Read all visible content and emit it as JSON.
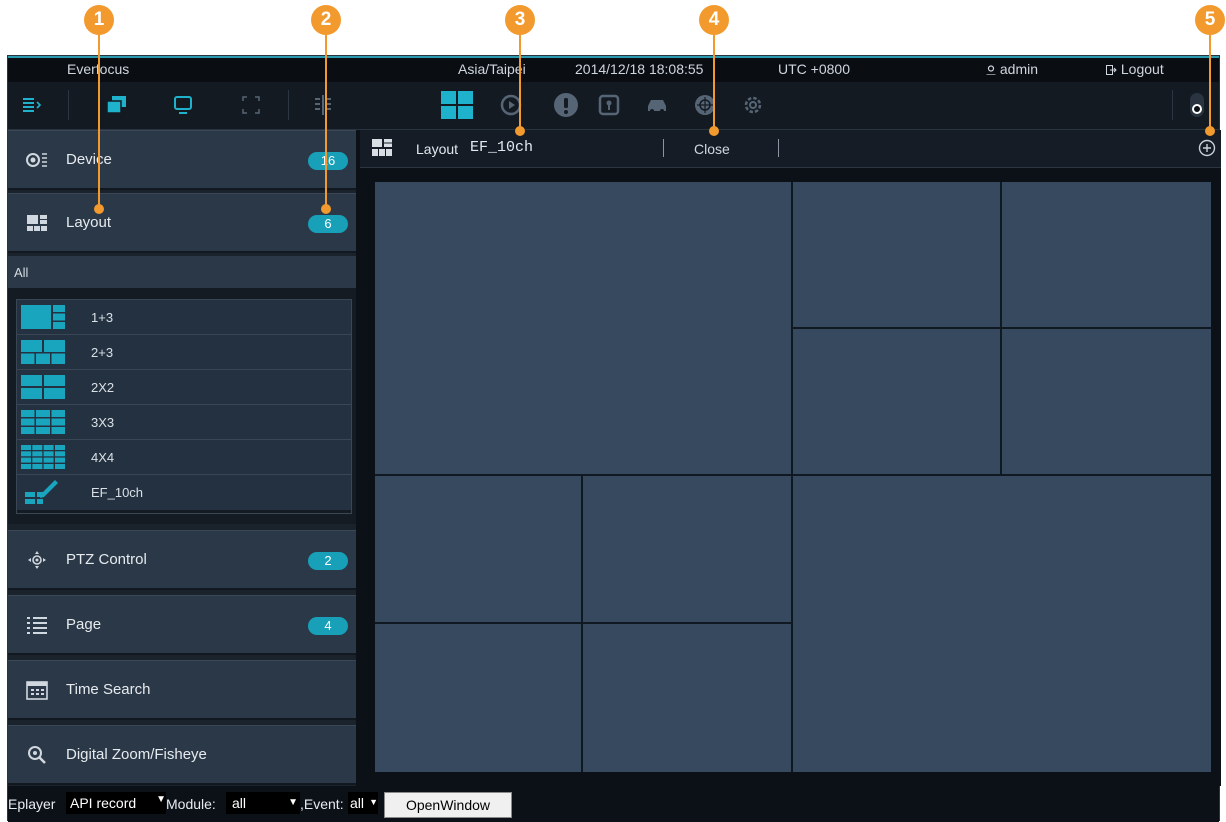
{
  "topbar": {
    "brand": "Everfocus",
    "timezone": "Asia/Taipei",
    "datetime": "2014/12/18 18:08:55",
    "utc": "UTC +0800",
    "user": "admin",
    "logout": "Logout"
  },
  "sidebar": {
    "device": {
      "label": "Device",
      "count": "16"
    },
    "layout": {
      "label": "Layout",
      "count": "6"
    },
    "filter": "All",
    "layouts": [
      {
        "label": "1+3"
      },
      {
        "label": "2+3"
      },
      {
        "label": "2X2"
      },
      {
        "label": "3X3"
      },
      {
        "label": "4X4"
      },
      {
        "label": "EF_10ch"
      }
    ],
    "ptz": {
      "label": "PTZ Control",
      "count": "2"
    },
    "page": {
      "label": "Page",
      "count": "4"
    },
    "time_search": {
      "label": "Time Search"
    },
    "digital_zoom": {
      "label": "Digital Zoom/Fisheye"
    }
  },
  "main": {
    "layout_prefix": "Layout",
    "layout_name": "EF_10ch",
    "close_label": "Close"
  },
  "bottombar": {
    "eplayer": "Eplayer",
    "api_value": "API record",
    "module_label": "Module:",
    "module_value": "all",
    "event_label": ",Event:",
    "event_value": "all",
    "open_button": "OpenWindow"
  },
  "markers": [
    "1",
    "2",
    "3",
    "4",
    "5"
  ],
  "colors": {
    "accent": "#17a0b8",
    "marker": "#f29a2e",
    "cell": "#36495e",
    "panel": "#2b3847"
  }
}
